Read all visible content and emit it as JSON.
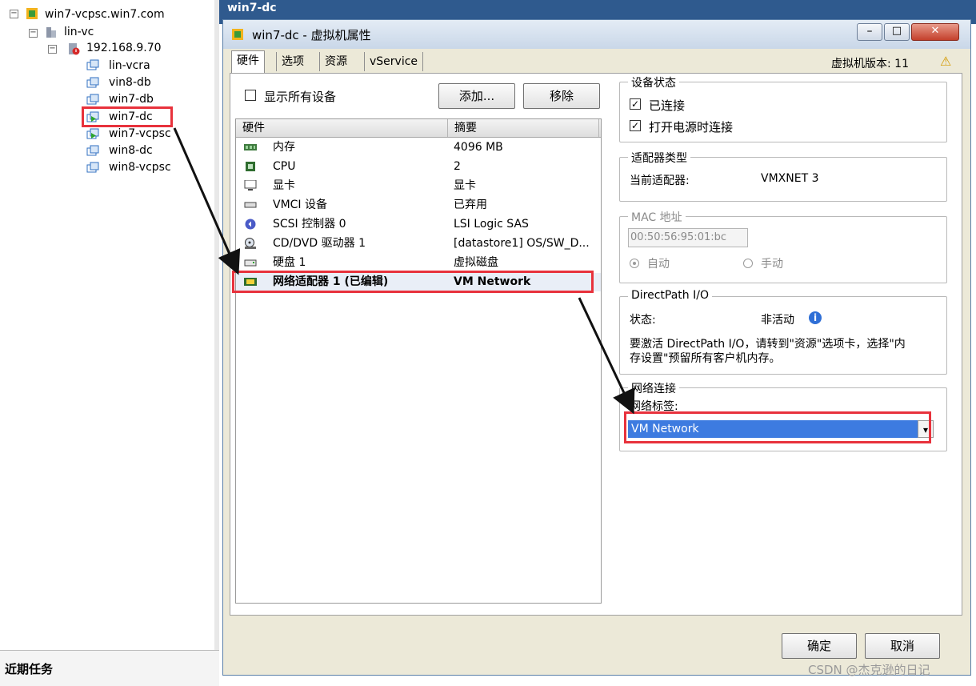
{
  "tree": {
    "root": "win7-vcpsc.win7.com",
    "datacenter": "lin-vc",
    "host": "192.168.9.70",
    "vms": [
      "lin-vcra",
      "vin8-db",
      "win7-db",
      "win7-dc",
      "win7-vcpsc",
      "win8-dc",
      "win8-vcpsc"
    ],
    "selected_vm": "win7-dc",
    "expand_glyph": "−"
  },
  "background_title": "win7-dc",
  "recent_tasks": "近期任务",
  "dialog": {
    "title": "win7-dc - 虚拟机属性",
    "tabs": [
      "硬件",
      "选项",
      "资源",
      "vService"
    ],
    "vm_version": "虚拟机版本: 11",
    "warning_glyph": "⚠",
    "show_all_devices": "显示所有设备",
    "add_button": "添加...",
    "remove_button": "移除",
    "table_headers": [
      "硬件",
      "摘要"
    ],
    "hardware": [
      {
        "name": "内存",
        "summary": "4096 MB",
        "icon": "memory-icon"
      },
      {
        "name": "CPU",
        "summary": "2",
        "icon": "cpu-icon"
      },
      {
        "name": "显卡",
        "summary": "显卡",
        "icon": "monitor-icon"
      },
      {
        "name": "VMCI 设备",
        "summary": "已弃用",
        "icon": "vmci-icon"
      },
      {
        "name": "SCSI 控制器 0",
        "summary": "LSI Logic SAS",
        "icon": "scsi-icon"
      },
      {
        "name": "CD/DVD 驱动器 1",
        "summary": "[datastore1] OS/SW_D...",
        "icon": "cdrom-icon"
      },
      {
        "name": "硬盘 1",
        "summary": "虚拟磁盘",
        "icon": "disk-icon"
      },
      {
        "name": "网络适配器 1 (已编辑)",
        "summary": "VM Network",
        "icon": "network-adapter-icon"
      }
    ],
    "device_status": {
      "title": "设备状态",
      "connected": "已连接",
      "connect_at_power_on": "打开电源时连接",
      "check_glyph": "✓"
    },
    "adapter_type": {
      "title": "适配器类型",
      "label": "当前适配器:",
      "value": "VMXNET 3"
    },
    "mac": {
      "title": "MAC 地址",
      "value": "00:50:56:95:01:bc",
      "auto": "自动",
      "manual": "手动"
    },
    "directpath": {
      "title": "DirectPath I/O",
      "status_label": "状态:",
      "status_value": "非活动",
      "info_glyph": "i",
      "note_line1": "要激活 DirectPath I/O，请转到\"资源\"选项卡，选择\"内",
      "note_line2": "存设置\"预留所有客户机内存。"
    },
    "network": {
      "title": "网络连接",
      "label_title": "网络标签:",
      "selected": "VM Network",
      "dropdown_glyph": "▾"
    },
    "ok_button": "确定",
    "cancel_button": "取消",
    "window_glyphs": {
      "minimize": "–",
      "maximize": "□",
      "close": "✕"
    }
  },
  "watermark": "CSDN @杰克逊的日记",
  "colors": {
    "highlight": "#e8323c",
    "selection": "#3d7be0",
    "titlebar": "#c9d7e8"
  }
}
